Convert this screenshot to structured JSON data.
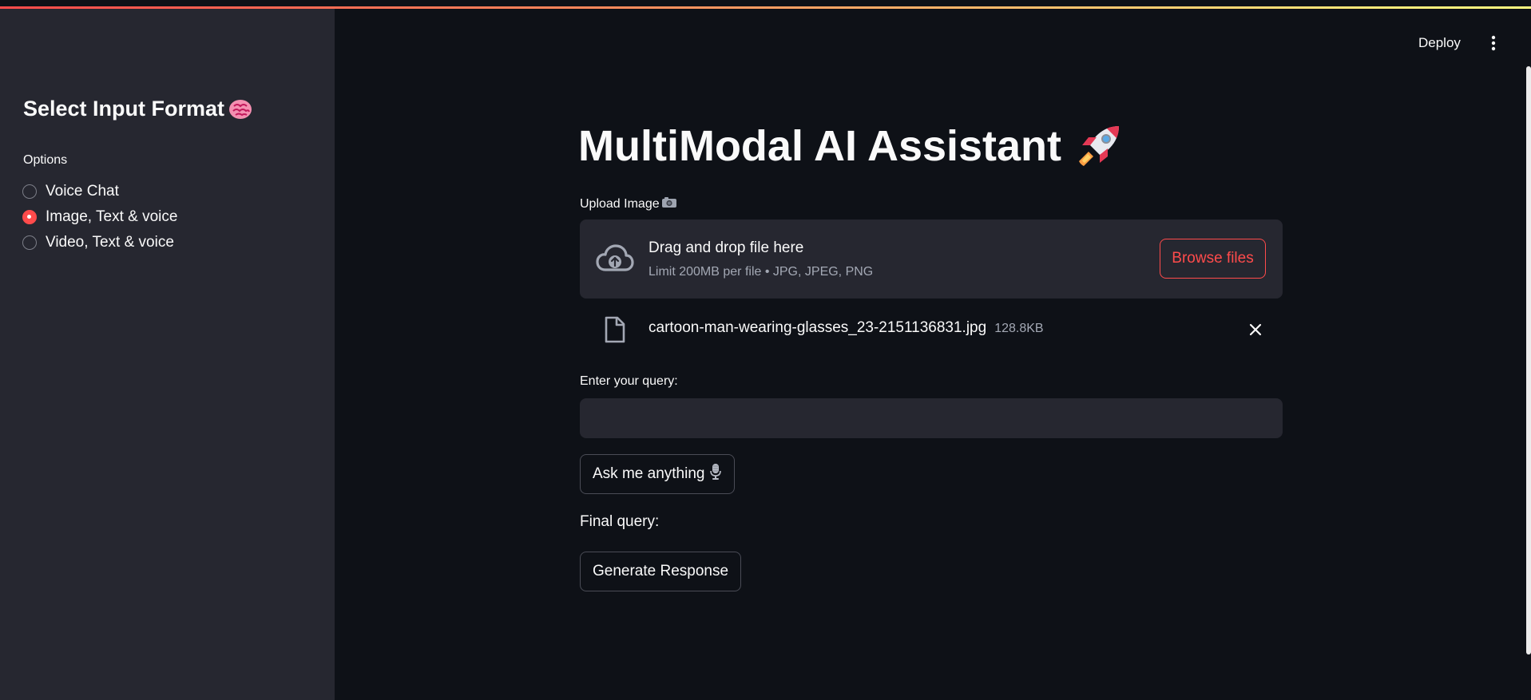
{
  "sidebar": {
    "title": "Select Input Format",
    "options_label": "Options",
    "options": [
      {
        "label": "Voice Chat",
        "selected": false
      },
      {
        "label": "Image, Text & voice",
        "selected": true
      },
      {
        "label": "Video, Text & voice",
        "selected": false
      }
    ]
  },
  "header": {
    "deploy_label": "Deploy",
    "menu_icon": "kebab-menu-icon"
  },
  "main": {
    "title": "MultiModal AI Assistant",
    "title_icon": "rocket-icon",
    "upload_label": "Upload Image",
    "upload_label_icon": "camera-icon",
    "uploader": {
      "drag_text": "Drag and drop file here",
      "limit_text": "Limit 200MB per file • JPG, JPEG, PNG",
      "browse_label": "Browse files"
    },
    "uploaded_file": {
      "name": "cartoon-man-wearing-glasses_23-2151136831.jpg",
      "size": "128.8KB"
    },
    "query_label": "Enter your query:",
    "query_value": "",
    "ask_button_label": "Ask me anything",
    "ask_button_icon": "microphone-icon",
    "final_query_label": "Final query:",
    "generate_button_label": "Generate Response"
  },
  "colors": {
    "accent": "#ff4b4b",
    "background": "#0e1117",
    "sidebar_bg": "#262730",
    "secondary_text": "#a3a8b4"
  }
}
